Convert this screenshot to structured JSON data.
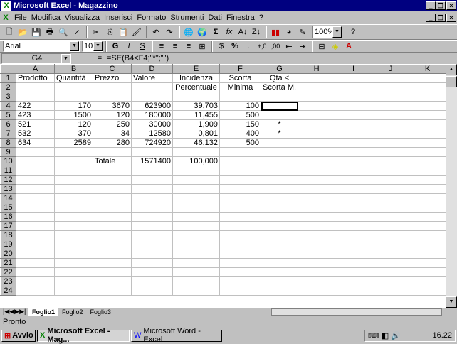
{
  "window": {
    "title": "Microsoft Excel - Magazzino"
  },
  "menu": [
    "File",
    "Modifica",
    "Visualizza",
    "Inserisci",
    "Formato",
    "Strumenti",
    "Dati",
    "Finestra",
    "?"
  ],
  "toolbar": {
    "zoom": "100%",
    "font": "Arial",
    "size": "10"
  },
  "formula_bar": {
    "cell": "G4",
    "eq": "=",
    "formula": "=SE(B4<F4;\"*\";\"\")"
  },
  "columns": [
    "A",
    "B",
    "C",
    "D",
    "E",
    "F",
    "G",
    "H",
    "I",
    "J",
    "K"
  ],
  "rows": [
    [
      "Prodotto",
      "Quantità",
      "Prezzo",
      "Valore",
      "Incidenza",
      "Scorta",
      "Qta <",
      "",
      "",
      "",
      ""
    ],
    [
      "",
      "",
      "",
      "",
      "Percentuale",
      "Minima",
      "Scorta M.",
      "",
      "",
      "",
      ""
    ],
    [
      "",
      "",
      "",
      "",
      "",
      "",
      "",
      "",
      "",
      "",
      ""
    ],
    [
      "422",
      "170",
      "3670",
      "623900",
      "39,703",
      "100",
      "",
      "",
      "",
      "",
      ""
    ],
    [
      "423",
      "1500",
      "120",
      "180000",
      "11,455",
      "500",
      "",
      "",
      "",
      "",
      ""
    ],
    [
      "521",
      "120",
      "250",
      "30000",
      "1,909",
      "150",
      "*",
      "",
      "",
      "",
      ""
    ],
    [
      "532",
      "370",
      "34",
      "12580",
      "0,801",
      "400",
      "*",
      "",
      "",
      "",
      ""
    ],
    [
      "634",
      "2589",
      "280",
      "724920",
      "46,132",
      "500",
      "",
      "",
      "",
      "",
      ""
    ],
    [
      "",
      "",
      "",
      "",
      "",
      "",
      "",
      "",
      "",
      "",
      ""
    ],
    [
      "",
      "",
      "Totale",
      "1571400",
      "100,000",
      "",
      "",
      "",
      "",
      "",
      ""
    ]
  ],
  "row_count": 24,
  "sheets": [
    "Foglio1",
    "Foglio2",
    "Foglio3"
  ],
  "status": "Pronto",
  "taskbar": {
    "start": "Avvio",
    "tasks": [
      "Microsoft Excel - Mag...",
      "Microsoft Word - Excel"
    ],
    "clock": "16.22"
  }
}
